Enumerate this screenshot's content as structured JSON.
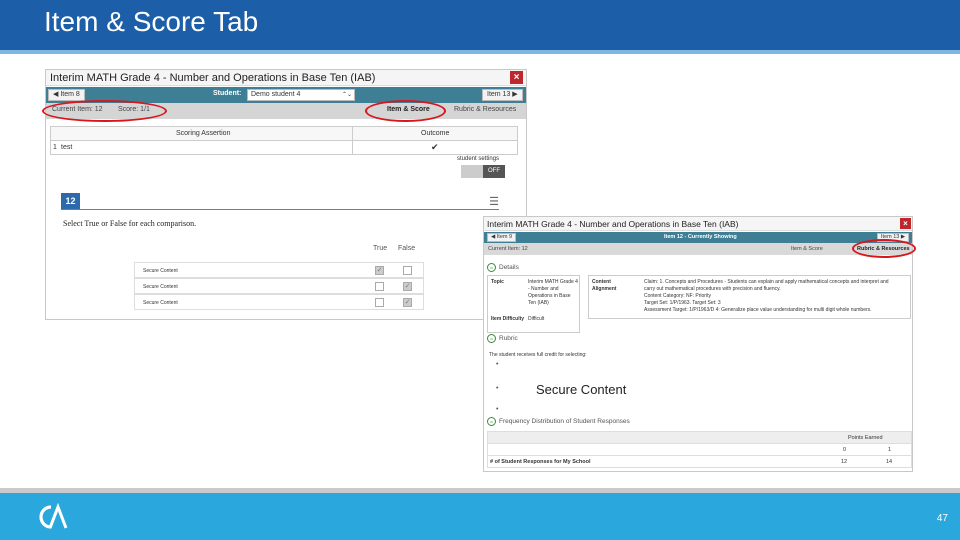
{
  "slide": {
    "title": "Item & Score Tab",
    "page_number": "47",
    "colors": {
      "title_bar": "#1c5ea8",
      "footer": "#2aa8dd",
      "highlight": "#d8161c"
    }
  },
  "shot1": {
    "title": "Interim MATH Grade 4 - Number and Operations in Base Ten (IAB)",
    "close": "×",
    "prev_item": "Item 8",
    "student_label": "Student:",
    "student_value": "Demo student 4",
    "next_item": "Item 13",
    "current_item": "Current Item: 12",
    "score": "Score: 1/1",
    "tab_item_score": "Item & Score",
    "tab_rubric": "Rubric & Resources",
    "table": {
      "col_assertion": "Scoring Assertion",
      "col_outcome": "Outcome",
      "row_index": "1",
      "row_text": "test",
      "row_outcome": "✔"
    },
    "student_settings": "student settings",
    "toggle_off": "OFF",
    "item_number": "12",
    "prompt": "Select True or False for each comparison.",
    "grid": {
      "col_true": "True",
      "col_false": "False",
      "rows": [
        {
          "label": "Secure Content",
          "true": true,
          "false": false
        },
        {
          "label": "Secure Content",
          "true": false,
          "false": true
        },
        {
          "label": "Secure Content",
          "true": false,
          "false": true
        }
      ]
    }
  },
  "shot2": {
    "title": "Interim MATH Grade 4 - Number and Operations in Base Ten (IAB)",
    "close": "×",
    "prev_item": "Item 9",
    "currently_showing": "Item 12 - Currently Showing",
    "next_item": "Item 13",
    "current_item": "Current Item: 12",
    "tab_item_score": "Item & Score",
    "tab_rubric": "Rubric & Resources",
    "details_header": "Details",
    "topic_key": "Topic",
    "topic_value": "Interim MATH Grade 4 - Number and Operations in Base Ten (IAB)",
    "difficulty_key": "Item Difficulty",
    "difficulty_value": "Difficult",
    "alignment_key": "Content Alignment",
    "alignment_lines": [
      "Claim: 1. Concepts and Procedures - Students can explain and apply mathematical concepts and interpret and",
      "carry out mathematical procedures with precision and fluency.",
      "Content Category: NF: Priority",
      "Target Set: 1/P/1963. Target Set: 3",
      "Assessment Target: 1/P/1963/D 4: Generalize place value understanding for multi digit whole numbers."
    ],
    "rubric_header": "Rubric",
    "rubric_text": "The student receives full credit for selecting:",
    "bullets": [
      "•",
      "•",
      "•"
    ],
    "secure_content": "Secure Content",
    "freq_header": "Frequency Distribution of Student Responses",
    "points_earned": "Points Earned",
    "points_cols": [
      "0",
      "1"
    ],
    "row_label": "# of Student Responses for My School",
    "row_values": [
      "12",
      "14"
    ]
  }
}
